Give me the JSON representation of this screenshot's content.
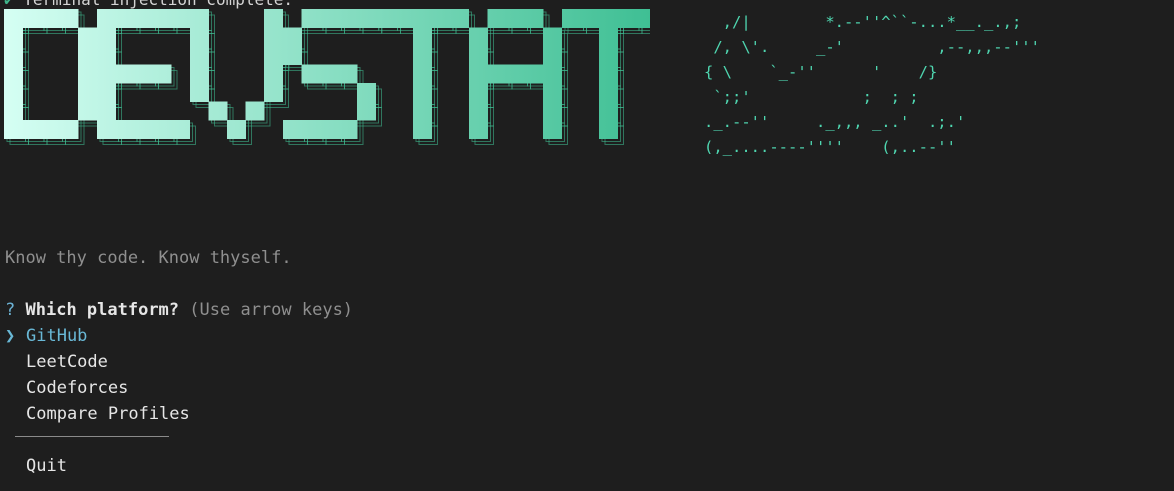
{
  "terminal": {
    "prev_line_check": "✔",
    "prev_line_text": "Terminal injection complete."
  },
  "logo": {
    "text": "DEVSTAT",
    "gradient_start": "#d6fff4",
    "gradient_end": "#3fbf94"
  },
  "ascii_art": {
    "lines": [
      "  ,/|        *.--''^``-...*__._.,;",
      " /, \\'.     _-'          ,--,,,--'''",
      "{ \\    `_-''      '    /}",
      " `;;'            ;  ; ;",
      "._.--''     ._,,, _..'  .;.'",
      "(,_....----''''    (,..--''"
    ],
    "color": "#4fd6b0"
  },
  "tagline": "Know thy code. Know thyself.",
  "prompt": {
    "marker": "?",
    "question": "Which platform?",
    "hint": "(Use arrow keys)"
  },
  "menu": {
    "pointer": "❯",
    "items": [
      {
        "label": "GitHub",
        "selected": true
      },
      {
        "label": "LeetCode",
        "selected": false
      },
      {
        "label": "Codeforces",
        "selected": false
      },
      {
        "label": "Compare Profiles",
        "selected": false
      }
    ],
    "quit_label": "Quit"
  }
}
